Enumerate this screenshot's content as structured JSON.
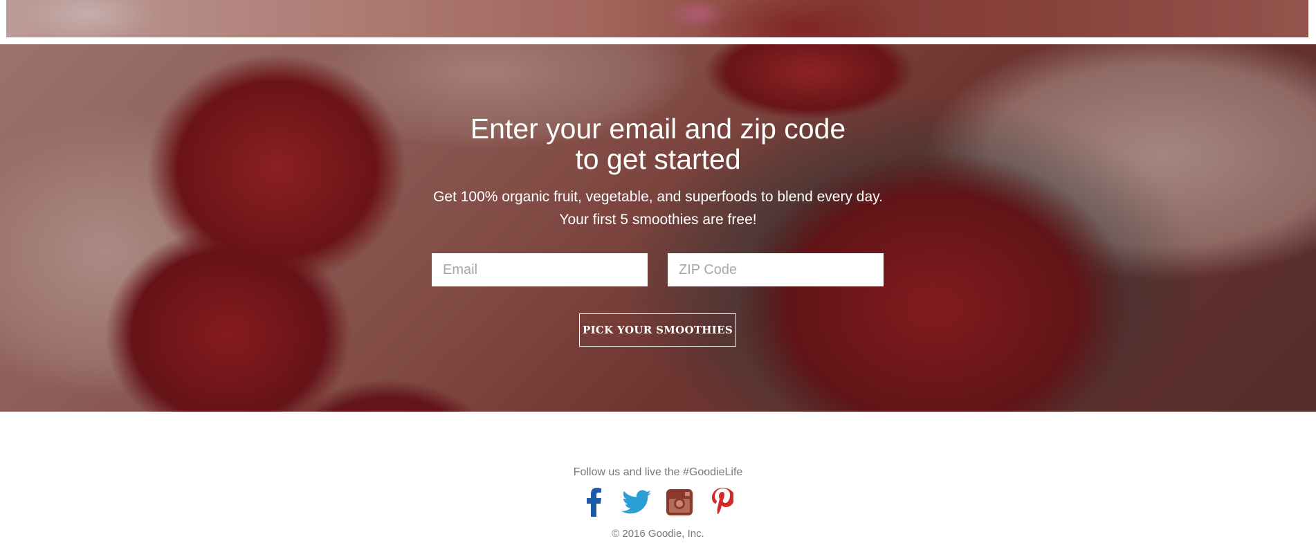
{
  "signup": {
    "title_line1": "Enter your email and zip code",
    "title_line2": "to get started",
    "subtitle": "Get 100% organic fruit, vegetable, and superfoods to blend every day. Your first 5 smoothies are free!",
    "email_placeholder": "Email",
    "zip_placeholder": "ZIP Code",
    "cta_label": "PICK YOUR SMOOTHIES"
  },
  "footer": {
    "follow_text": "Follow us and live the #GoodieLife",
    "copyright": "© 2016 Goodie, Inc.",
    "socials": [
      {
        "icon": "facebook-icon",
        "color": "#1a5aa8"
      },
      {
        "icon": "twitter-icon",
        "color": "#2a9fd6"
      },
      {
        "icon": "instagram-icon",
        "color": "#8a3a2a"
      },
      {
        "icon": "pinterest-icon",
        "color": "#d42a27"
      }
    ]
  }
}
